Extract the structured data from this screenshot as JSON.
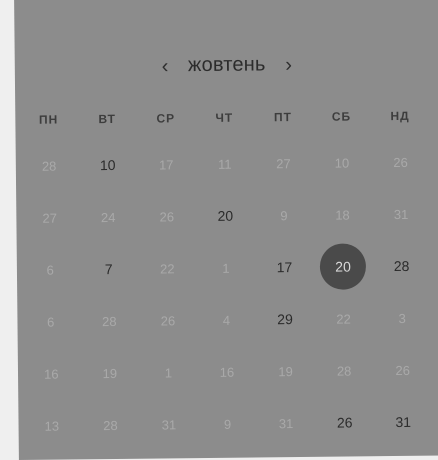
{
  "calendar": {
    "month": "жовтень",
    "prev_icon": "chevron-left-icon",
    "next_icon": "chevron-right-icon",
    "prev_glyph": "‹",
    "next_glyph": "›",
    "weekdays": [
      "ПН",
      "ВТ",
      "СР",
      "ЧТ",
      "ПТ",
      "СБ",
      "НД"
    ],
    "weeks": [
      [
        {
          "d": "28",
          "a": false
        },
        {
          "d": "10",
          "a": true
        },
        {
          "d": "17",
          "a": false
        },
        {
          "d": "11",
          "a": false
        },
        {
          "d": "27",
          "a": false
        },
        {
          "d": "10",
          "a": false
        },
        {
          "d": "26",
          "a": false
        }
      ],
      [
        {
          "d": "27",
          "a": false
        },
        {
          "d": "24",
          "a": false
        },
        {
          "d": "26",
          "a": false
        },
        {
          "d": "20",
          "a": true
        },
        {
          "d": "9",
          "a": false
        },
        {
          "d": "18",
          "a": false
        },
        {
          "d": "31",
          "a": false
        }
      ],
      [
        {
          "d": "6",
          "a": false
        },
        {
          "d": "7",
          "a": true
        },
        {
          "d": "22",
          "a": false
        },
        {
          "d": "1",
          "a": false
        },
        {
          "d": "17",
          "a": true
        },
        {
          "d": "20",
          "a": true,
          "selected": true
        },
        {
          "d": "28",
          "a": true
        }
      ],
      [
        {
          "d": "6",
          "a": false
        },
        {
          "d": "28",
          "a": false
        },
        {
          "d": "26",
          "a": false
        },
        {
          "d": "4",
          "a": false
        },
        {
          "d": "29",
          "a": true
        },
        {
          "d": "22",
          "a": false
        },
        {
          "d": "3",
          "a": false
        }
      ],
      [
        {
          "d": "16",
          "a": false
        },
        {
          "d": "19",
          "a": false
        },
        {
          "d": "1",
          "a": false
        },
        {
          "d": "16",
          "a": false
        },
        {
          "d": "19",
          "a": false
        },
        {
          "d": "28",
          "a": false
        },
        {
          "d": "26",
          "a": false
        }
      ],
      [
        {
          "d": "13",
          "a": false
        },
        {
          "d": "28",
          "a": false
        },
        {
          "d": "31",
          "a": false
        },
        {
          "d": "9",
          "a": false
        },
        {
          "d": "31",
          "a": false
        },
        {
          "d": "26",
          "a": true
        },
        {
          "d": "31",
          "a": true
        }
      ]
    ]
  }
}
